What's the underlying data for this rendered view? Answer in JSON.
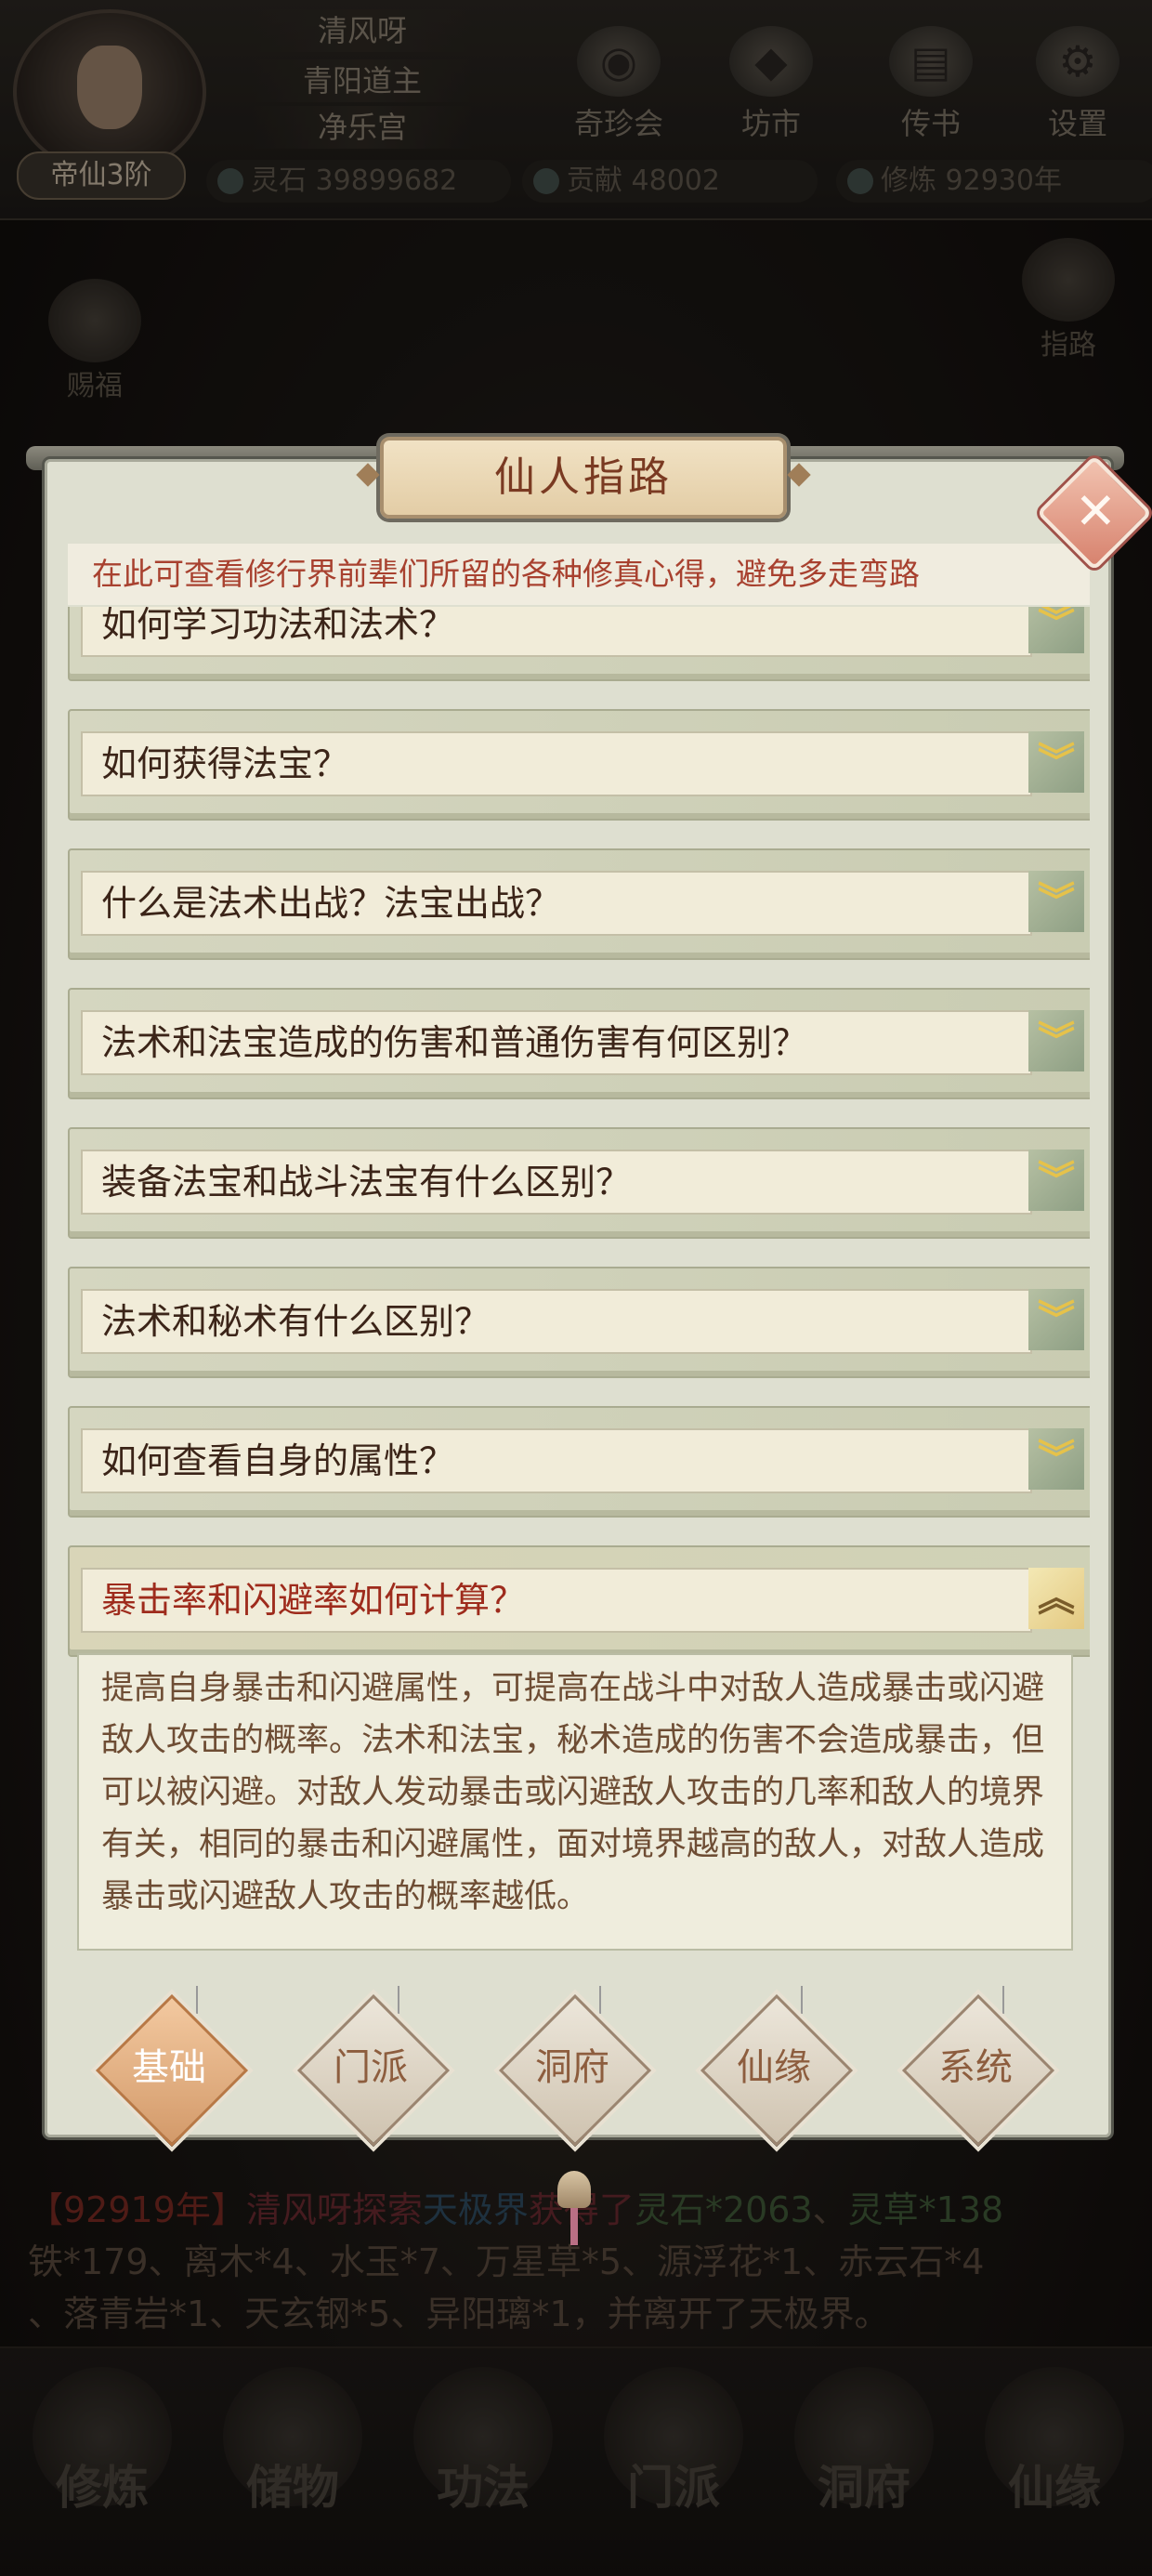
{
  "player": {
    "names": [
      "清风呀",
      "青阳道主",
      "净乐宫"
    ],
    "rank": "帝仙3阶"
  },
  "top_buttons": [
    "奇珍会",
    "坊市",
    "传书",
    "设置"
  ],
  "resources": [
    {
      "label": "灵石",
      "value": "39899682"
    },
    {
      "label": "贡献",
      "value": "48002"
    },
    {
      "label": "修炼",
      "value": "92930年"
    }
  ],
  "side_left": "赐福",
  "side_right": "指路",
  "modal": {
    "title": "仙人指路",
    "close_symbol": "✕",
    "intro": "在此可查看修行界前辈们所留的各种修真心得，避免多走弯路",
    "questions": [
      "如何学习功法和法术？",
      "如何获得法宝？",
      "什么是法术出战？法宝出战？",
      "法术和法宝造成的伤害和普通伤害有何区别？",
      "装备法宝和战斗法宝有什么区别？",
      "法术和秘术有什么区别？",
      "如何查看自身的属性？",
      "暴击率和闪避率如何计算？"
    ],
    "open_index": 7,
    "answer": "提高自身暴击和闪避属性，可提高在战斗中对敌人造成暴击或闪避敌人攻击的概率。法术和法宝，秘术造成的伤害不会造成暴击，但可以被闪避。对敌人发动暴击或闪避敌人攻击的几率和敌人的境界有关，相同的暴击和闪避属性，面对境界越高的敌人，对敌人造成暴击或闪避敌人攻击的概率越低。",
    "tabs": [
      "基础",
      "门派",
      "洞府",
      "仙缘",
      "系统"
    ],
    "active_tab": 0
  },
  "log": {
    "year": "【92919年】",
    "line1_a": "清风呀探索",
    "place": "天极界",
    "line1_b": "获得了",
    "item1": "灵石*2063",
    "item2": "灵草*138",
    "line2": "铁*179、离木*4、水玉*7、万星草*5、源浮花*1、赤云石*4",
    "line3": "、落青岩*1、天玄钢*5、异阳璃*1，并离开了天极界。"
  },
  "bottom_nav": [
    "修炼",
    "储物",
    "功法",
    "门派",
    "洞府",
    "仙缘"
  ],
  "icons": {
    "close": "close-icon",
    "expand": "chevron-down-icon",
    "collapse": "chevron-up-icon"
  },
  "colors": {
    "panel_bg": "#dedfd0",
    "title_text": "#7a3a22",
    "intro_text": "#a8412f",
    "open_question": "#9e2b1c",
    "answer_text": "#6e4d34",
    "arrow": "#e6c24a"
  }
}
